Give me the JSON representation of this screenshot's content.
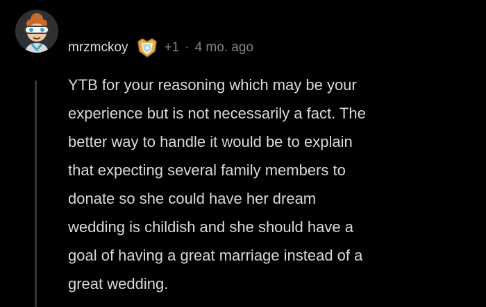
{
  "comment": {
    "username": "mrzmckoy",
    "flair_icon": "award-badge-icon",
    "points": "+1",
    "separator": "·",
    "age": "4 mo. ago",
    "body_lines": [
      "YTB for your reasoning which may be your",
      "experience but is not necessarily a fact. The",
      "better way to handle it would be to explain",
      "that expecting several family members to",
      "donate so she could have her dream",
      "wedding is childish and she should have a",
      "goal of having a great marriage instead of a",
      "great wedding."
    ]
  },
  "colors": {
    "background": "#000000",
    "text": "#d7dadc",
    "muted": "#818384",
    "thread_line": "#343536"
  }
}
